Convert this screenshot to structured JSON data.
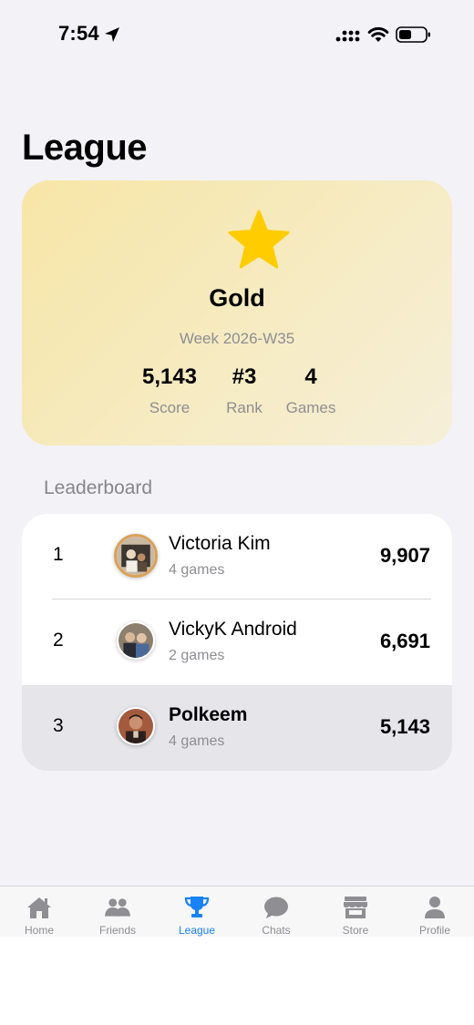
{
  "status_bar": {
    "time": "7:54"
  },
  "page": {
    "title": "League"
  },
  "league_card": {
    "tier": "Gold",
    "week": "Week 2026-W35",
    "stats": [
      {
        "value": "5,143",
        "label": "Score"
      },
      {
        "value": "#3",
        "label": "Rank"
      },
      {
        "value": "4",
        "label": "Games"
      }
    ],
    "star_color": "#ffcc00"
  },
  "leaderboard": {
    "header": "Leaderboard",
    "rows": [
      {
        "rank": "1",
        "name": "Victoria Kim",
        "games": "4 games",
        "score": "9,907"
      },
      {
        "rank": "2",
        "name": "VickyK Android",
        "games": "2 games",
        "score": "6,691"
      },
      {
        "rank": "3",
        "name": "Polkeem",
        "games": "4 games",
        "score": "5,143",
        "is_current_user": true
      }
    ]
  },
  "tab_bar": {
    "tabs": [
      {
        "label": "Home",
        "icon": "house-icon"
      },
      {
        "label": "Friends",
        "icon": "people-icon"
      },
      {
        "label": "League",
        "icon": "trophy-icon",
        "active": true
      },
      {
        "label": "Chats",
        "icon": "chat-bubble-icon"
      },
      {
        "label": "Store",
        "icon": "storefront-icon"
      },
      {
        "label": "Profile",
        "icon": "person-icon"
      }
    ],
    "active_color": "#1a82f7",
    "inactive_color": "#8e8e93"
  }
}
